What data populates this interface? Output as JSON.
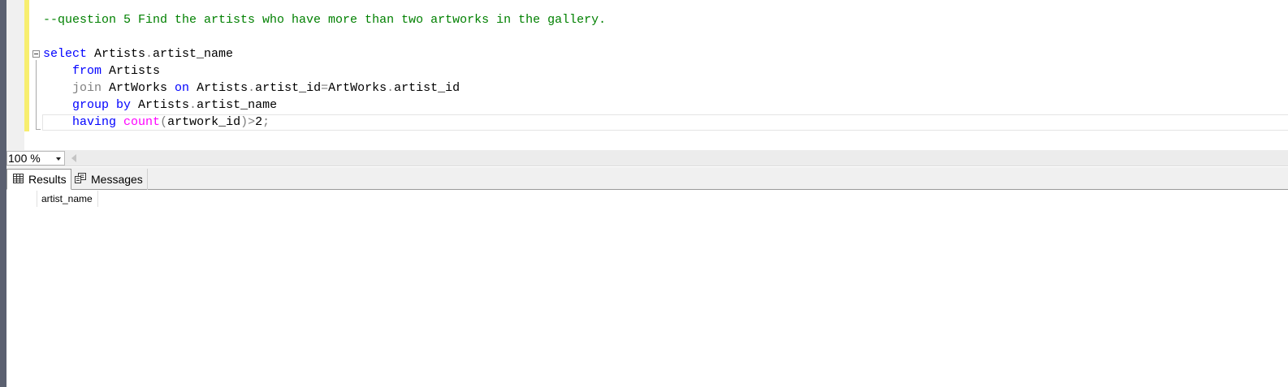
{
  "editor": {
    "lines": [
      [
        {
          "t": "--question 5 Find the artists who have more than two artworks in the gallery.",
          "c": "cm"
        }
      ],
      [],
      [
        {
          "t": "select",
          "c": "kw"
        },
        {
          "t": " Artists",
          "c": ""
        },
        {
          "t": ".",
          "c": "gr"
        },
        {
          "t": "artist_name",
          "c": ""
        }
      ],
      [
        {
          "t": "    ",
          "c": ""
        },
        {
          "t": "from",
          "c": "kw"
        },
        {
          "t": " Artists",
          "c": ""
        }
      ],
      [
        {
          "t": "    ",
          "c": ""
        },
        {
          "t": "join",
          "c": "gr"
        },
        {
          "t": " ArtWorks ",
          "c": ""
        },
        {
          "t": "on",
          "c": "kw"
        },
        {
          "t": " Artists",
          "c": ""
        },
        {
          "t": ".",
          "c": "gr"
        },
        {
          "t": "artist_id",
          "c": ""
        },
        {
          "t": "=",
          "c": "gr"
        },
        {
          "t": "ArtWorks",
          "c": ""
        },
        {
          "t": ".",
          "c": "gr"
        },
        {
          "t": "artist_id",
          "c": ""
        }
      ],
      [
        {
          "t": "    ",
          "c": ""
        },
        {
          "t": "group by",
          "c": "kw"
        },
        {
          "t": " Artists",
          "c": ""
        },
        {
          "t": ".",
          "c": "gr"
        },
        {
          "t": "artist_name",
          "c": ""
        }
      ],
      [
        {
          "t": "    ",
          "c": ""
        },
        {
          "t": "having",
          "c": "kw"
        },
        {
          "t": " ",
          "c": ""
        },
        {
          "t": "count",
          "c": "fn"
        },
        {
          "t": "(",
          "c": "gr"
        },
        {
          "t": "artwork_id",
          "c": ""
        },
        {
          "t": ")>",
          "c": "gr"
        },
        {
          "t": "2",
          "c": ""
        },
        {
          "t": ";",
          "c": "gr"
        }
      ]
    ]
  },
  "zoom": {
    "value": "100 %"
  },
  "tabs": {
    "results": "Results",
    "messages": "Messages"
  },
  "grid": {
    "columns": [
      "artist_name"
    ]
  },
  "icons": {
    "results_tab": "grid-icon",
    "messages_tab": "messages-icon"
  }
}
